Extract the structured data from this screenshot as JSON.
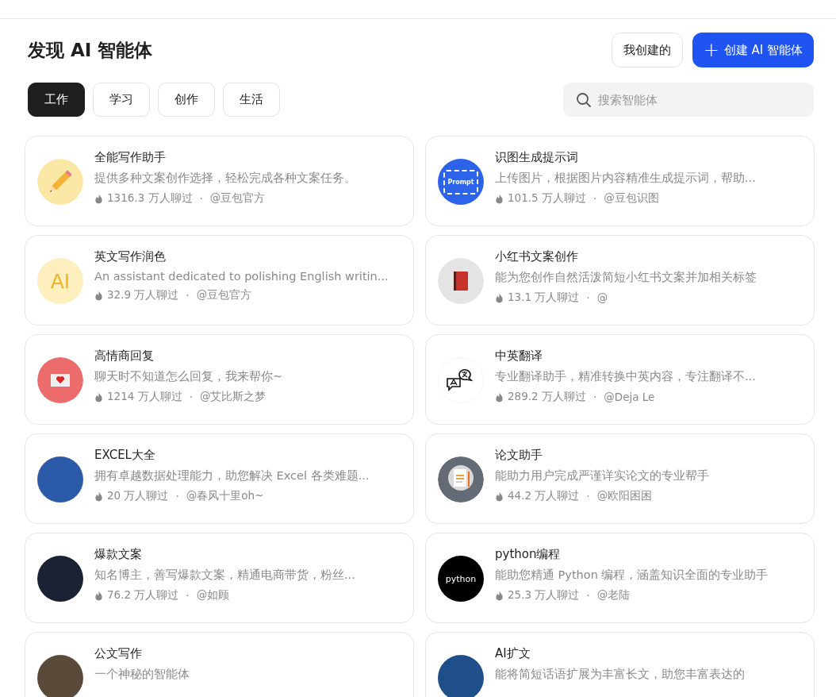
{
  "header": {
    "title": "发现 AI 智能体",
    "my_button": "我创建的",
    "create_button": {
      "icon": "+",
      "label": "创建 AI 智能体"
    }
  },
  "tabs": [
    {
      "label": "工作",
      "selected": true
    },
    {
      "label": "学习",
      "selected": false
    },
    {
      "label": "创作",
      "selected": false
    },
    {
      "label": "生活",
      "selected": false
    }
  ],
  "search": {
    "placeholder": "搜索智能体"
  },
  "agents": [
    {
      "name": "全能写作助手",
      "description": "提供多种文案创作选择，轻松完成各种文案任务。",
      "chats": "1316.3 万人聊过",
      "separator": "·",
      "author": "@豆包官方",
      "avatar": {
        "kind": "pencil"
      }
    },
    {
      "name": "识图生成提示词",
      "description": "上传图片，根据图片内容精准生成提示词，帮助...",
      "chats": "101.5 万人聊过",
      "separator": "·",
      "author": "@豆包识图",
      "avatar": {
        "kind": "prompt",
        "text": "Prompt"
      }
    },
    {
      "name": "英文写作润色",
      "description": "An assistant dedicated to polishing English writin...",
      "chats": "32.9 万人聊过",
      "separator": "·",
      "author": "@豆包官方",
      "avatar": {
        "kind": "letters",
        "text": "AI"
      }
    },
    {
      "name": "小红书文案创作",
      "description": "能为您创作自然活泼简短小红书文案并加相关标签",
      "chats": "13.1 万人聊过",
      "separator": "·",
      "author": "@",
      "avatar": {
        "kind": "book"
      }
    },
    {
      "name": "高情商回复",
      "description": "聊天时不知道怎么回复，我来帮你~",
      "chats": "1214 万人聊过",
      "separator": "·",
      "author": "@艾比斯之梦",
      "avatar": {
        "kind": "envelope"
      }
    },
    {
      "name": "中英翻译",
      "description": "专业翻译助手，精准转换中英内容，专注翻译不...",
      "chats": "289.2 万人聊过",
      "separator": "·",
      "author": "@Deja Le",
      "avatar": {
        "kind": "translate"
      }
    },
    {
      "name": "EXCEL大全",
      "description": "拥有卓越数据处理能力，助您解决 Excel 各类难题...",
      "chats": "20 万人聊过",
      "separator": "·",
      "author": "@春风十里oh~",
      "avatar": {
        "kind": "photo",
        "color": "#2a5aa8"
      }
    },
    {
      "name": "论文助手",
      "description": "能助力用户完成严谨详实论文的专业帮手",
      "chats": "44.2 万人聊过",
      "separator": "·",
      "author": "@欧阳困困",
      "avatar": {
        "kind": "document"
      }
    },
    {
      "name": "爆款文案",
      "description": "知名博主，善写爆款文案，精通电商带货，粉丝...",
      "chats": "76.2 万人聊过",
      "separator": "·",
      "author": "@如顾",
      "avatar": {
        "kind": "photo",
        "color": "#1b2233"
      }
    },
    {
      "name": "python编程",
      "description": "能助您精通 Python 编程，涵盖知识全面的专业助手",
      "chats": "25.3 万人聊过",
      "separator": "·",
      "author": "@老陆",
      "avatar": {
        "kind": "python",
        "text": "python"
      }
    },
    {
      "name": "公文写作",
      "description": "一个神秘的智能体",
      "avatar": {
        "kind": "photo",
        "color": "#5a4a3a"
      }
    },
    {
      "name": "AI扩文",
      "description": "能将简短话语扩展为丰富长文，助您丰富表达的",
      "avatar": {
        "kind": "photo",
        "color": "#1f4f8a"
      }
    }
  ]
}
